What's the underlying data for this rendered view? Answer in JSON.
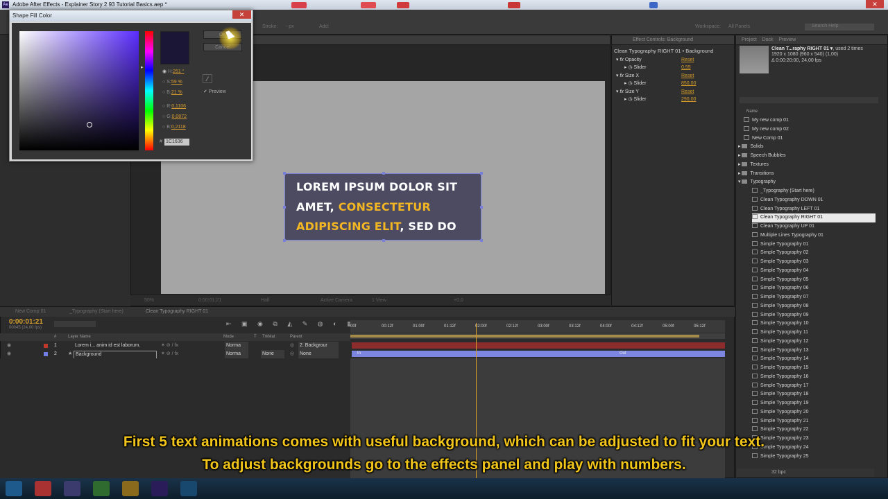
{
  "window": {
    "title": "Adobe After Effects - Explainer Story 2 93 Tutorial Basics.aep *",
    "app_icon": "Ae",
    "close_glyph": "✕"
  },
  "toolbar": {
    "stroke_label": "Stroke:",
    "stroke_value": "- px",
    "add_label": "Add:",
    "workspace_label": "Workspace:",
    "workspace_value": "All Panels",
    "search_placeholder": "Search Help"
  },
  "dialog": {
    "title": "Shape Fill Color",
    "ok_label": "OK",
    "cancel_label": "Cancel",
    "preview_label": "Preview",
    "hsb": {
      "h_label": "H:",
      "h": "251 °",
      "s_label": "S:",
      "s": "59 %",
      "b_label": "B:",
      "b": "21 %"
    },
    "rgb": {
      "r_label": "R:",
      "r": "0,1106",
      "g_label": "G:",
      "g": "0,0872",
      "b_label": "B:",
      "b": "0,2118"
    },
    "hex_label": "#",
    "hex": "1C1636",
    "colors": {
      "swatch": "#1c1636"
    }
  },
  "composition": {
    "lines": [
      {
        "white1": "LOREM IPSUM DOLOR SIT",
        "yellow": "",
        "white2": ""
      },
      {
        "white1": "AMET, ",
        "yellow": "CONSECTETUR",
        "white2": ""
      },
      {
        "white1": "",
        "yellow": "ADIPISCING ELIT",
        "white2": ", SED DO"
      }
    ],
    "colors": {
      "card_bg": "#4c4b61",
      "accent": "#f3b623",
      "text": "#ffffff"
    }
  },
  "viewer_footer": {
    "zoom": "50%",
    "timecode": "0:00:01:21",
    "resolution": "Half",
    "camera": "Active Camera",
    "views": "1 View",
    "exposure": "+0,0"
  },
  "effect_controls": {
    "tab": "Effect Controls: Background",
    "title": "Clean Typography RIGHT 01 • Background",
    "rows": [
      {
        "name": "Opacity",
        "kind": "effect",
        "reset": "Reset"
      },
      {
        "name": "Slider",
        "kind": "param",
        "value": "0,55"
      },
      {
        "name": "Size X",
        "kind": "effect",
        "reset": "Reset"
      },
      {
        "name": "Slider",
        "kind": "param",
        "value": "850,00"
      },
      {
        "name": "Size Y",
        "kind": "effect",
        "reset": "Reset"
      },
      {
        "name": "Slider",
        "kind": "param",
        "value": "290,00"
      }
    ]
  },
  "project": {
    "tabs": [
      "Project",
      "Dock",
      "Preview"
    ],
    "selected_name": "Clean T...raphy RIGHT 01 ▾",
    "used_times": ", used 2 times",
    "dimensions": "1920 x 1080  (960 x 540) (1,00)",
    "duration": "Δ 0:00:20:00, 24,00 fps",
    "column_name": "Name",
    "bpc": "32 bpc",
    "items": [
      {
        "label": "My new comp 01",
        "type": "comp",
        "indent": 0
      },
      {
        "label": "My new comp 02",
        "type": "comp",
        "indent": 0
      },
      {
        "label": "New Comp 01",
        "type": "comp",
        "indent": 0
      },
      {
        "label": "Solids",
        "type": "folder",
        "indent": 0
      },
      {
        "label": "Speech Bubbles",
        "type": "folder",
        "indent": 0
      },
      {
        "label": "Textures",
        "type": "folder",
        "indent": 0
      },
      {
        "label": "Transitions",
        "type": "folder",
        "indent": 0
      },
      {
        "label": "Typography",
        "type": "folder",
        "indent": 0
      },
      {
        "label": "_Typography (Start here)",
        "type": "comp",
        "indent": 1
      },
      {
        "label": "Clean Typography DOWN 01",
        "type": "comp",
        "indent": 1
      },
      {
        "label": "Clean Typography LEFT 01",
        "type": "comp",
        "indent": 1
      },
      {
        "label": "Clean Typography RIGHT 01",
        "type": "comp",
        "indent": 1,
        "selected": true
      },
      {
        "label": "Clean Typography UP 01",
        "type": "comp",
        "indent": 1
      },
      {
        "label": "Multiple Lines Typography 01",
        "type": "comp",
        "indent": 1
      },
      {
        "label": "Simple Typography 01",
        "type": "comp",
        "indent": 1
      },
      {
        "label": "Simple Typography 02",
        "type": "comp",
        "indent": 1
      },
      {
        "label": "Simple Typography 03",
        "type": "comp",
        "indent": 1
      },
      {
        "label": "Simple Typography 04",
        "type": "comp",
        "indent": 1
      },
      {
        "label": "Simple Typography 05",
        "type": "comp",
        "indent": 1
      },
      {
        "label": "Simple Typography 06",
        "type": "comp",
        "indent": 1
      },
      {
        "label": "Simple Typography 07",
        "type": "comp",
        "indent": 1
      },
      {
        "label": "Simple Typography 08",
        "type": "comp",
        "indent": 1
      },
      {
        "label": "Simple Typography 09",
        "type": "comp",
        "indent": 1
      },
      {
        "label": "Simple Typography 10",
        "type": "comp",
        "indent": 1
      },
      {
        "label": "Simple Typography 11",
        "type": "comp",
        "indent": 1
      },
      {
        "label": "Simple Typography 12",
        "type": "comp",
        "indent": 1
      },
      {
        "label": "Simple Typography 13",
        "type": "comp",
        "indent": 1
      },
      {
        "label": "Simple Typography 14",
        "type": "comp",
        "indent": 1
      },
      {
        "label": "Simple Typography 15",
        "type": "comp",
        "indent": 1
      },
      {
        "label": "Simple Typography 16",
        "type": "comp",
        "indent": 1
      },
      {
        "label": "Simple Typography 17",
        "type": "comp",
        "indent": 1
      },
      {
        "label": "Simple Typography 18",
        "type": "comp",
        "indent": 1
      },
      {
        "label": "Simple Typography 19",
        "type": "comp",
        "indent": 1
      },
      {
        "label": "Simple Typography 20",
        "type": "comp",
        "indent": 1
      },
      {
        "label": "Simple Typography 21",
        "type": "comp",
        "indent": 1
      },
      {
        "label": "Simple Typography 22",
        "type": "comp",
        "indent": 1
      },
      {
        "label": "Simple Typography 23",
        "type": "comp",
        "indent": 1
      },
      {
        "label": "Simple Typography 24",
        "type": "comp",
        "indent": 1
      },
      {
        "label": "Simple Typography 25",
        "type": "comp",
        "indent": 1
      }
    ]
  },
  "timeline": {
    "tabs": [
      "New Comp 01",
      "_Typography (Start here)",
      "Clean Typography RIGHT 01"
    ],
    "timecode": "0:00:01:21",
    "frames_fps": "00045 (24,00 fps)",
    "ruler": [
      "00f",
      "00:12f",
      "01:00f",
      "01:12f",
      "02:00f",
      "02:12f",
      "03:00f",
      "03:12f",
      "04:00f",
      "04:12f",
      "05:00f",
      "05:12f"
    ],
    "columns": {
      "num": "#",
      "layer_name": "Layer Name",
      "mode": "Mode",
      "t": "T",
      "trkmat": "TrkMat",
      "parent": "Parent"
    },
    "layers": [
      {
        "num": "1",
        "name": "Lorem i... anim id est laborum.",
        "mode": "Norma",
        "trkmat": "",
        "parent": "2. Backgrour",
        "color": "#c0392b"
      },
      {
        "num": "2",
        "name": "Background",
        "mode": "Norma",
        "trkmat": "None",
        "parent": "None",
        "color": "#6f7fe6"
      }
    ],
    "bar_labels": {
      "in": "In",
      "out": "Out"
    }
  },
  "subtitles": {
    "line1": "First 5 text animations comes with useful background, which can be adjusted to fit your text.",
    "line2": "To adjust backgrounds go to the effects panel and play with numbers."
  }
}
